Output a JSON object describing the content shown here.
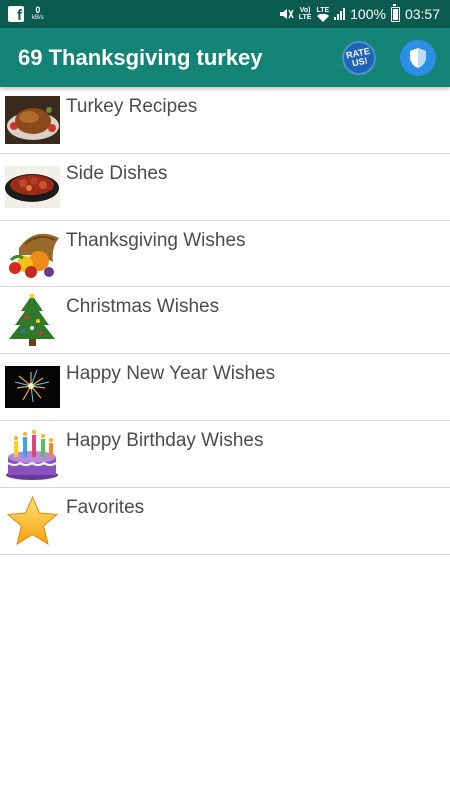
{
  "status_bar": {
    "net_speed": "0",
    "net_unit": "kB/s",
    "volte_top": "Vo)",
    "volte_bottom": "LTE",
    "lte_label": "LTE",
    "battery": "100%",
    "time": "03:57"
  },
  "app_bar": {
    "title": "69 Thanksgiving turkey",
    "rate_top": "RATE",
    "rate_bottom": "US!"
  },
  "menu": {
    "items": [
      {
        "label": "Turkey Recipes",
        "icon": "turkey-recipes-thumbnail"
      },
      {
        "label": "Side Dishes",
        "icon": "side-dishes-thumbnail"
      },
      {
        "label": "Thanksgiving Wishes",
        "icon": "cornucopia-icon"
      },
      {
        "label": "Christmas Wishes",
        "icon": "christmas-tree-icon"
      },
      {
        "label": "Happy New Year Wishes",
        "icon": "fireworks-icon"
      },
      {
        "label": "Happy Birthday Wishes",
        "icon": "birthday-cake-icon"
      },
      {
        "label": "Favorites",
        "icon": "star-icon"
      }
    ]
  },
  "colors": {
    "status_bar": "#0a5a4f",
    "app_bar": "#138476",
    "text": "#4c4c4c",
    "divider": "#d9d9d9"
  }
}
